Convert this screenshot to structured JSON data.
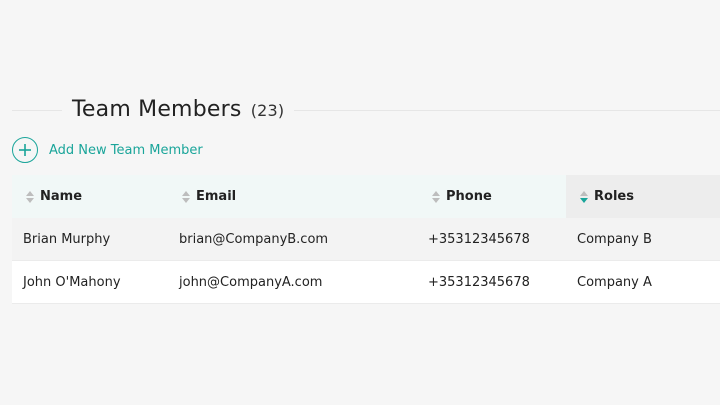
{
  "header": {
    "title": "Team Members",
    "count": "(23)"
  },
  "actions": {
    "add_member_label": "Add New Team Member"
  },
  "table": {
    "columns": [
      {
        "label": "Name",
        "sorted": false
      },
      {
        "label": "Email",
        "sorted": false
      },
      {
        "label": "Phone",
        "sorted": false
      },
      {
        "label": "Roles",
        "sorted": true,
        "direction": "desc"
      }
    ],
    "rows": [
      [
        "Brian Murphy",
        "brian@CompanyB.com",
        "+35312345678",
        "Company B"
      ],
      [
        "John O'Mahony",
        "john@CompanyA.com",
        "+35312345678",
        "Company A"
      ]
    ]
  },
  "colors": {
    "accent": "#1aa59a",
    "header_bg": "#f1f8f7",
    "active_header_bg": "#ededed",
    "page_bg": "#f6f6f6"
  },
  "icons": {
    "add": "plus-circle-icon",
    "sort": "sort-arrows-icon"
  }
}
